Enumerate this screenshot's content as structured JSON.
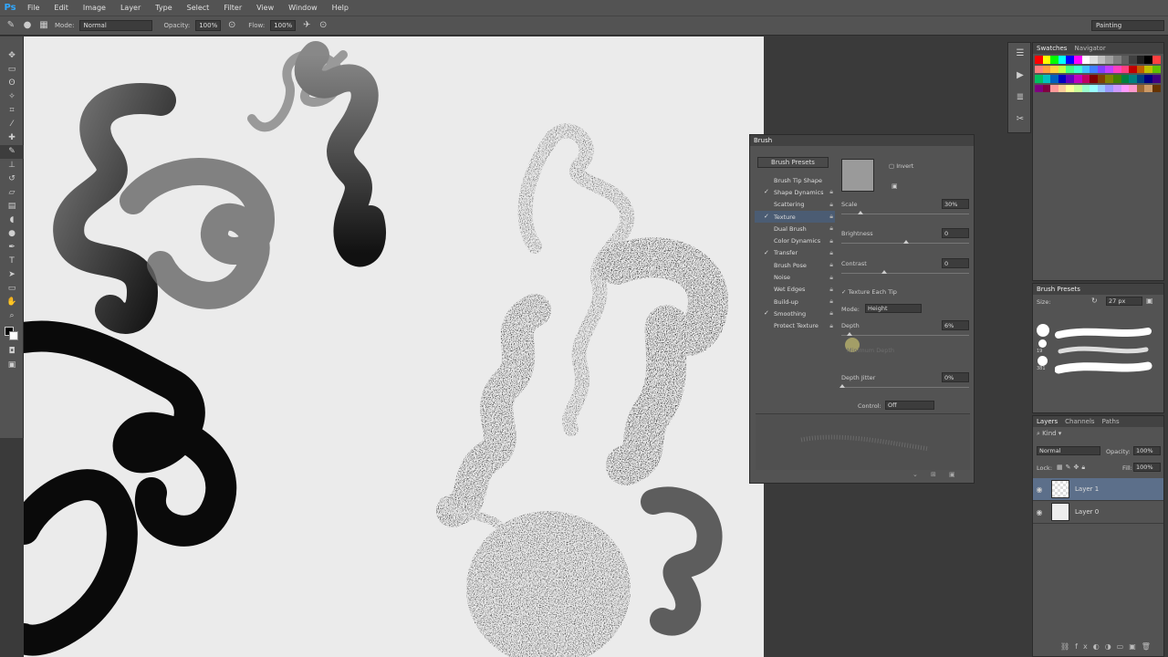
{
  "app": {
    "logo": "Ps"
  },
  "menu": [
    "File",
    "Edit",
    "Image",
    "Layer",
    "Type",
    "Select",
    "Filter",
    "View",
    "Window",
    "Help"
  ],
  "options": {
    "mode_label": "Mode:",
    "mode_value": "Normal",
    "opacity_label": "Opacity:",
    "opacity_value": "100%",
    "flow_label": "Flow:",
    "flow_value": "100%",
    "workspace": "Painting"
  },
  "brush_panel": {
    "title": "Brush",
    "presets_button": "Brush Presets",
    "items": [
      {
        "label": "Brush Tip Shape",
        "check": ""
      },
      {
        "label": "Shape Dynamics",
        "check": "✓"
      },
      {
        "label": "Scattering",
        "check": ""
      },
      {
        "label": "Texture",
        "check": "✓"
      },
      {
        "label": "Dual Brush",
        "check": ""
      },
      {
        "label": "Color Dynamics",
        "check": ""
      },
      {
        "label": "Transfer",
        "check": "✓"
      },
      {
        "label": "Brush Pose",
        "check": ""
      },
      {
        "label": "Noise",
        "check": ""
      },
      {
        "label": "Wet Edges",
        "check": ""
      },
      {
        "label": "Build-up",
        "check": ""
      },
      {
        "label": "Smoothing",
        "check": "✓"
      },
      {
        "label": "Protect Texture",
        "check": ""
      }
    ],
    "invert_label": "Invert",
    "scale_label": "Scale",
    "scale_value": "30%",
    "brightness_label": "Brightness",
    "brightness_value": "0",
    "contrast_label": "Contrast",
    "contrast_value": "0",
    "texture_each_tip": "Texture Each Tip",
    "mode_label": "Mode:",
    "mode_value": "Height",
    "depth_label": "Depth",
    "depth_value": "6%",
    "min_depth_label": "Minimum Depth",
    "depth_jitter_label": "Depth Jitter",
    "depth_jitter_value": "0%",
    "control_label": "Control:",
    "control_value": "Off"
  },
  "swatches_panel": {
    "tabs": [
      "Swatches",
      "Navigator"
    ],
    "colors": [
      "#ff0000",
      "#ffff00",
      "#00ff00",
      "#00ffff",
      "#0000ff",
      "#ff00ff",
      "#ffffff",
      "#e0e0e0",
      "#c0c0c0",
      "#a0a0a0",
      "#808080",
      "#606060",
      "#404040",
      "#202020",
      "#000000",
      "#ff4040",
      "#ff8080",
      "#ffa040",
      "#ffd040",
      "#c0ff40",
      "#40ff80",
      "#40ffd0",
      "#40c0ff",
      "#4080ff",
      "#8040ff",
      "#c040ff",
      "#ff40c0",
      "#ff4080",
      "#c00000",
      "#c06000",
      "#c0c000",
      "#60c000",
      "#00c060",
      "#00c0c0",
      "#0060c0",
      "#0000c0",
      "#6000c0",
      "#c000c0",
      "#c00060",
      "#800000",
      "#804000",
      "#808000",
      "#408000",
      "#008040",
      "#008080",
      "#004080",
      "#000080",
      "#400080",
      "#800080",
      "#800040",
      "#ff9999",
      "#ffcc99",
      "#ffff99",
      "#ccff99",
      "#99ffcc",
      "#99ffff",
      "#99ccff",
      "#9999ff",
      "#cc99ff",
      "#ff99ff",
      "#ff99cc",
      "#996633",
      "#cc9966",
      "#663300"
    ]
  },
  "brush_presets_panel": {
    "title": "Brush Presets",
    "size_label": "Size:",
    "size_value": "27 px",
    "sizes": [
      "19",
      "381"
    ]
  },
  "layers_panel": {
    "tabs": [
      "Layers",
      "Channels",
      "Paths"
    ],
    "kind_label": "Kind",
    "blend_mode": "Normal",
    "opacity_label": "Opacity:",
    "opacity_value": "100%",
    "lock_label": "Lock:",
    "fill_label": "Fill:",
    "fill_value": "100%",
    "layers": [
      {
        "name": "Layer 1"
      },
      {
        "name": "Layer 0"
      }
    ]
  }
}
